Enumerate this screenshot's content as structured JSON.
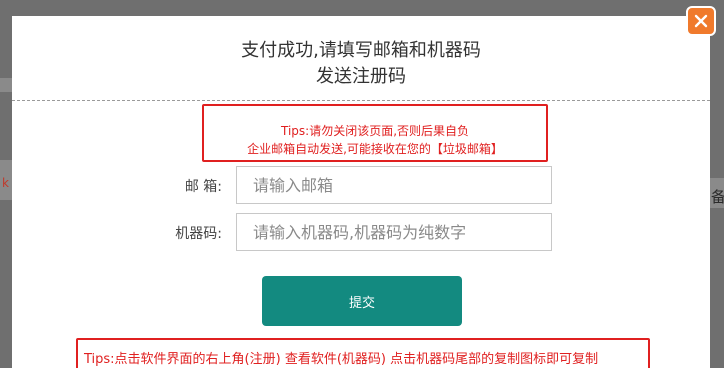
{
  "modal": {
    "title_line1": "支付成功,请填写邮箱和机器码",
    "title_line2": "发送注册码",
    "tips_line1": "Tips:请勿关闭该页面,否则后果自负",
    "tips_line2": "企业邮箱自动发送,可能接收在您的【垃圾邮箱】",
    "email_label": "邮 箱:",
    "email_placeholder": "请输入邮箱",
    "machine_label": "机器码:",
    "machine_placeholder": "请输入机器码,机器码为纯数字",
    "submit_label": "提交",
    "bottom_tips": "Tips:点击软件界面的右上角(注册) 查看软件(机器码) 点击机器码尾部的复制图标即可复制"
  },
  "background": {
    "right_fragment": "备",
    "left_fragment": "k"
  },
  "close_icon": "close-icon",
  "colors": {
    "accent": "#138a80",
    "warning": "#e02020",
    "close": "#f07a2c"
  }
}
